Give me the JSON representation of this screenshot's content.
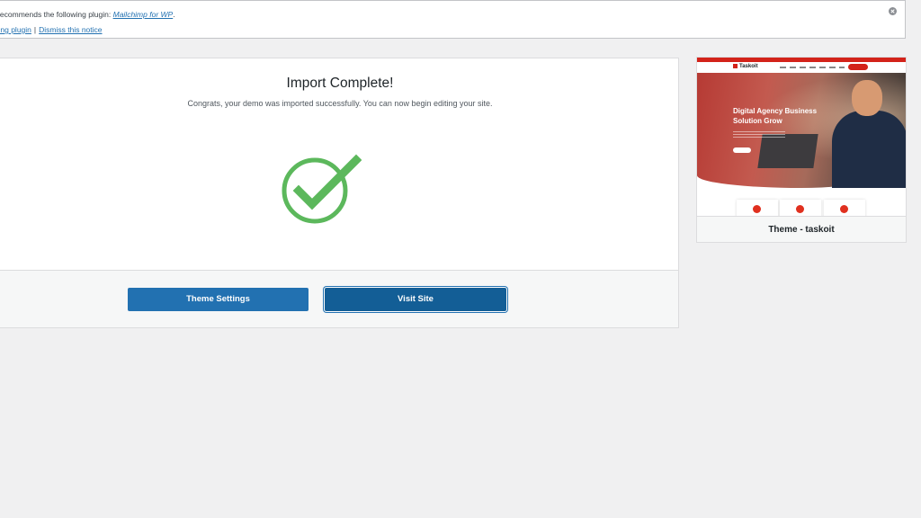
{
  "notice": {
    "prefix": "e recommends the following plugin: ",
    "plugin_link": "Mailchimp for WP",
    "suffix": ".",
    "action_link": "alling plugin",
    "separator": "|",
    "dismiss_link": "Dismiss this notice",
    "dismiss_icon": "close-circle-icon"
  },
  "import": {
    "title": "Import Complete!",
    "message": "Congrats, your demo was imported successfully. You can now begin editing your site.",
    "status_icon": "checkmark-circle-icon",
    "status_color": "#5cb85c"
  },
  "actions": {
    "theme_settings_label": "Theme Settings",
    "visit_site_label": "Visit Site"
  },
  "theme_card": {
    "name": "Theme - taskoit",
    "preview": {
      "logo": "Taskoit",
      "hero_title_line1": "Digital Agency Business",
      "hero_title_line2": "Solution Grow",
      "accent": "#d3231a"
    }
  },
  "colors": {
    "primary_button": "#2271b1",
    "primary_button_focus": "#135e96",
    "link": "#2271b1"
  }
}
